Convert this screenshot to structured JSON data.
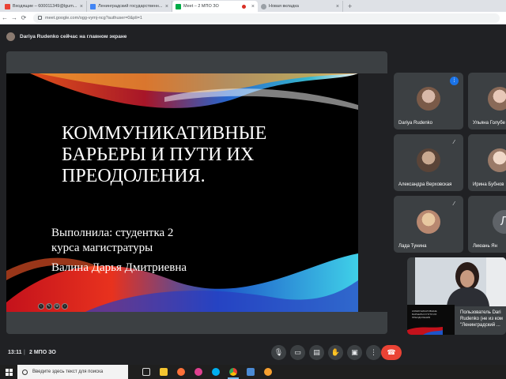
{
  "browser": {
    "tabs": [
      {
        "label": "Входящие – 600011349@lgum...",
        "favicon_color": "#ea4335",
        "active": false
      },
      {
        "label": "Ленинградский государственн...",
        "favicon_color": "#4285f4",
        "active": false
      },
      {
        "label": "Meet – 2 МПО ЗО",
        "favicon_color": "#00ac47",
        "active": true,
        "recording": true
      },
      {
        "label": "Новая вкладка",
        "favicon_color": "#9aa0a6",
        "active": false
      }
    ],
    "url": "meet.google.com/ogg-vymj-ncg?authuser=0&pli=1"
  },
  "meet": {
    "presenter_notice": "Dariya Rudenko сейчас на главном экране",
    "slide": {
      "title": "КОММУНИКАТИВНЫЕ БАРЬЕРЫ И ПУТИ ИХ ПРЕОДОЛЕНИЯ.",
      "line1": "Выполнила: студентка 2",
      "line2": "курса магистратуры",
      "line3": "Валина Дарья Дмитриевна"
    },
    "participants": [
      {
        "name": "Dariya Rudenko",
        "mic": "speaking"
      },
      {
        "name": "Ульяна Голубе",
        "mic": "none"
      },
      {
        "name": "Александра Верховская",
        "mic": "muted"
      },
      {
        "name": "Ирина Бубнов",
        "mic": "none"
      },
      {
        "name": "Лада Тунина",
        "mic": "muted"
      },
      {
        "name": "Лиюань Ян",
        "mic": "none",
        "initial": "Л"
      }
    ],
    "self_caption": "Пользователь Dari Rudenko (не из ком \"Ленинградский ...",
    "self_thumb_text": "КОММУНИКАТИВНЫЕ БАРЬЕРЫ И ПУТИ ИХ ПРЕОДОЛЕНИЯ",
    "time": "13:11",
    "separator": "|",
    "meeting_name": "2 МПО ЗО"
  },
  "taskbar": {
    "search_placeholder": "Введите здесь текст для поиска"
  },
  "colors": {
    "meet_bg": "#202124",
    "tile_bg": "#3c4043",
    "end_call": "#ea4335",
    "speaking": "#1a73e8"
  }
}
